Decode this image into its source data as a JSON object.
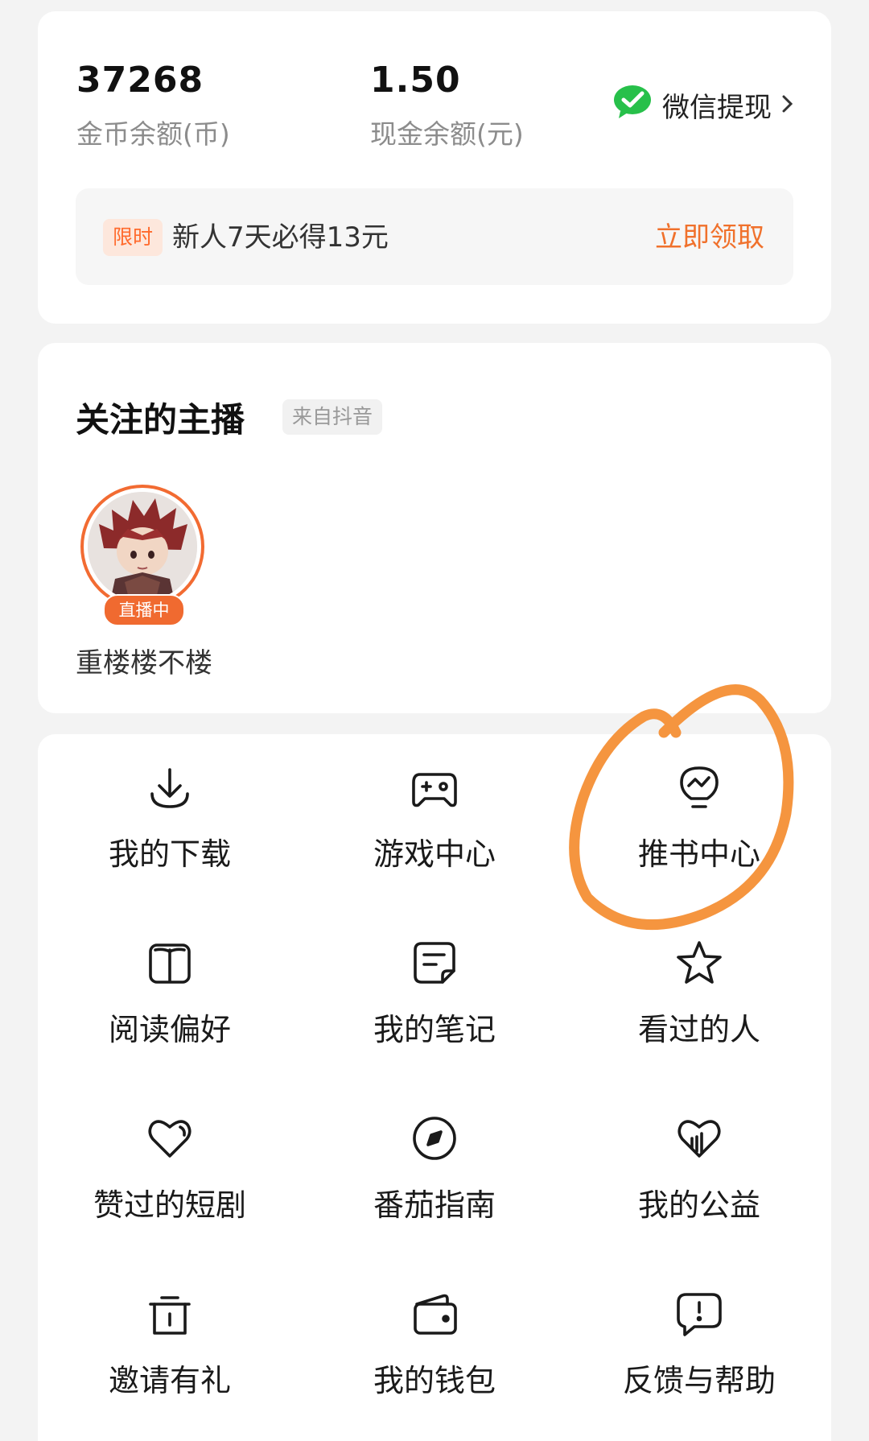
{
  "wallet": {
    "coin_balance": "37268",
    "coin_label": "金币余额(币)",
    "cash_balance": "1.50",
    "cash_label": "现金余额(元)",
    "withdraw_label": "微信提现",
    "withdraw_icon": "wechat-icon",
    "promo": {
      "tag": "限时",
      "text": "新人7天必得13元",
      "action": "立即领取"
    }
  },
  "streamers": {
    "title": "关注的主播",
    "source_tag": "来自抖音",
    "items": [
      {
        "name": "重楼楼不楼",
        "badge": "直播中"
      }
    ]
  },
  "menu": {
    "items": [
      {
        "label": "我的下载",
        "icon": "download-icon"
      },
      {
        "label": "游戏中心",
        "icon": "gamepad-icon"
      },
      {
        "label": "推书中心",
        "icon": "lightbulb-icon"
      },
      {
        "label": "阅读偏好",
        "icon": "book-icon"
      },
      {
        "label": "我的笔记",
        "icon": "note-icon"
      },
      {
        "label": "看过的人",
        "icon": "star-icon"
      },
      {
        "label": "赞过的短剧",
        "icon": "heart-icon"
      },
      {
        "label": "番茄指南",
        "icon": "compass-icon"
      },
      {
        "label": "我的公益",
        "icon": "charity-heart-icon"
      },
      {
        "label": "邀请有礼",
        "icon": "gift-box-icon"
      },
      {
        "label": "我的钱包",
        "icon": "wallet-icon"
      },
      {
        "label": "反馈与帮助",
        "icon": "feedback-icon"
      }
    ]
  },
  "colors": {
    "accent": "#f0712c",
    "annotation": "#f5953f",
    "background": "#f3f3f3"
  }
}
